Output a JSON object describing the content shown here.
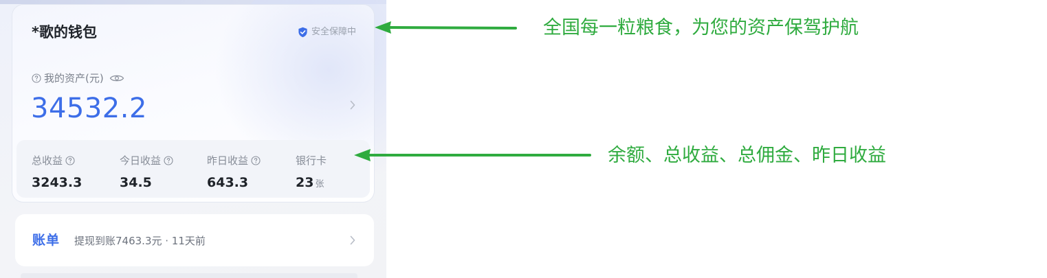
{
  "wallet": {
    "title": "*歌的钱包",
    "security_label": "安全保障中",
    "assets_label": "我的资产(元)",
    "assets_value": "34532.2"
  },
  "stats": [
    {
      "label": "总收益",
      "value": "3243.3",
      "unit": ""
    },
    {
      "label": "今日收益",
      "value": "34.5",
      "unit": ""
    },
    {
      "label": "昨日收益",
      "value": "643.3",
      "unit": ""
    },
    {
      "label": "银行卡",
      "value": "23",
      "unit": "张"
    }
  ],
  "bill": {
    "tag": "账单",
    "text": "提现到账7463.3元 · 11天前"
  },
  "annotations": {
    "security_note": "全国每一粒粮食，为您的资产保驾护航",
    "stats_note": "余额、总收益、总佣金、昨日收益"
  },
  "colors": {
    "accent_blue": "#3d6ee8",
    "annotation_green": "#2fab3f"
  },
  "icons": [
    "shield-check-icon",
    "question-circle-icon",
    "eye-icon",
    "chevron-right-icon",
    "arrow-left-icon"
  ]
}
